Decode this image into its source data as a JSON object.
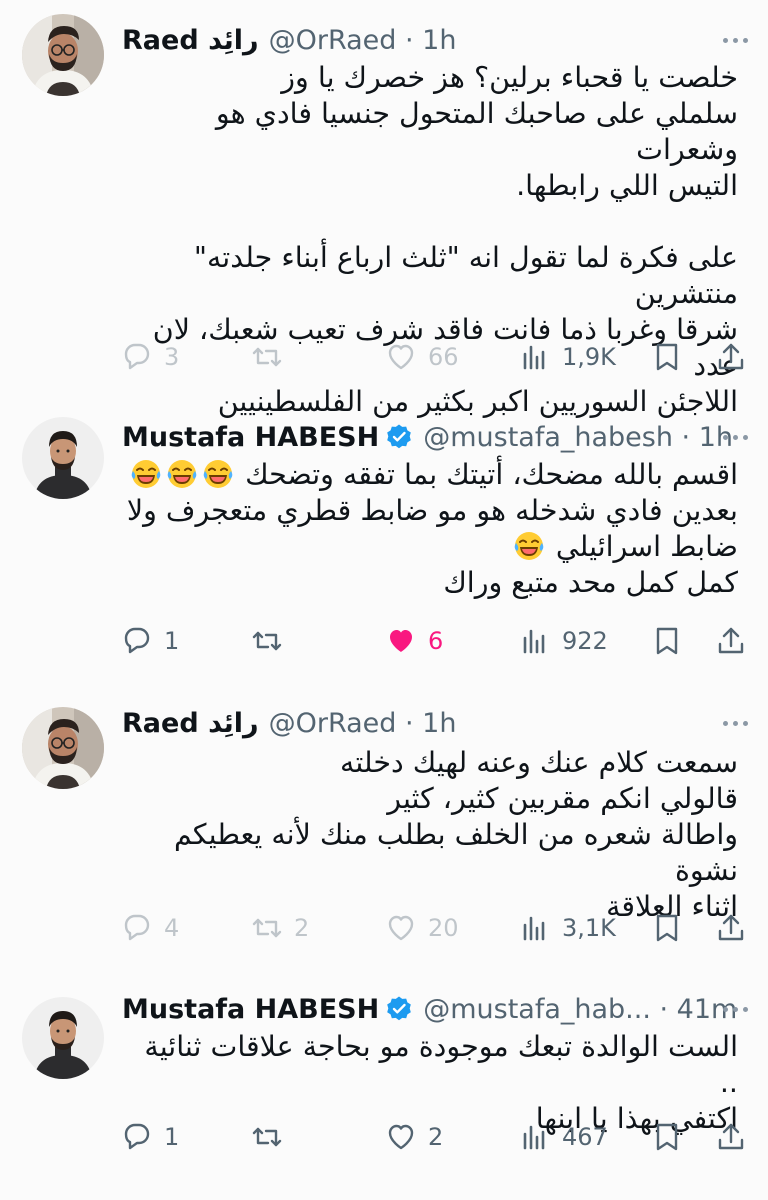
{
  "tweets": [
    {
      "author_name": "Raed رائِد",
      "meta": "@OrRaed · 1h",
      "verified": false,
      "lines": [
        "خلصت يا قحباء برلين؟ هز خصرك يا وز",
        "سلملي على صاحبك المتحول جنسيا فادي هو وشعرات",
        "التيس اللي رابطها.",
        "",
        "على فكرة لما تقول انه \"ثلث ارباع أبناء جلدته\" منتشرين",
        "شرقا وغربا ذما فانت فاقد شرف تعيب شعبك، لان عدد",
        "اللاجئن السوريين اكبر بكثير من الفلسطينيين"
      ],
      "replies": "3",
      "reposts": "",
      "likes": "66",
      "views": "1,9K",
      "faded": true
    },
    {
      "author_name": "Mustafa HABESH",
      "meta": "@mustafa_habesh · 1h",
      "verified": true,
      "lines": [
        "اقسم بالله مضحك، أتيتك بما تفقه وتضحك",
        "بعدين فادي شدخله هو مو ضابط قطري متعجرف ولا",
        "ضابط اسرائيلي",
        "كمل كمل محد متبع وراك"
      ],
      "replies": "1",
      "reposts": "",
      "likes": "6",
      "views": "922",
      "faded": false
    },
    {
      "author_name": "Raed رائِد",
      "meta": "@OrRaed · 1h",
      "verified": false,
      "lines": [
        "سمعت كلام عنك وعنه لهيك دخلته",
        "قالولي انكم مقربين كثير، كثير",
        "واطالة شعره من الخلف بطلب منك لأنه يعطيكم نشوة",
        "اثناء العلاقة"
      ],
      "replies": "4",
      "reposts": "2",
      "likes": "20",
      "views": "3,1K",
      "faded": true
    },
    {
      "author_name": "Mustafa HABESH",
      "meta": "@mustafa_hab... · 41m",
      "verified": true,
      "lines": [
        "الست الوالدة تبعك موجودة مو بحاجة علاقات ثنائية ..",
        "اكتفي بهذا يا ابنها"
      ],
      "replies": "1",
      "reposts": "",
      "likes": "2",
      "views": "467",
      "faded": false
    }
  ],
  "icons": {
    "reply": "reply-icon",
    "repost": "repost-icon",
    "like": "heart-icon",
    "views": "views-icon",
    "bookmark": "bookmark-icon",
    "share": "share-icon",
    "emoji": "laughing-tears-emoji"
  },
  "colors": {
    "verified": "#1d9bf0",
    "liked": "#f91880",
    "secondary_text": "#536471"
  }
}
